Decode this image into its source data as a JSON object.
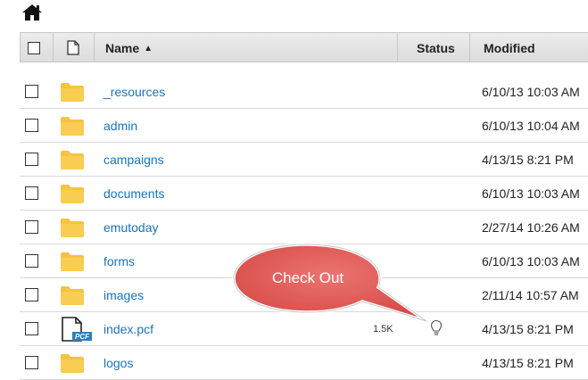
{
  "toolbar": {
    "home_icon": "home-icon"
  },
  "table": {
    "columns": {
      "name": "Name",
      "status": "Status",
      "modified": "Modified"
    },
    "sort": {
      "column": "Name",
      "direction": "ascending",
      "icon": "sort-ascending-icon"
    },
    "rows": [
      {
        "name": "_resources",
        "type": "folder",
        "size": "",
        "status_icon": "",
        "modified": "6/10/13 10:03 AM"
      },
      {
        "name": "admin",
        "type": "folder",
        "size": "",
        "status_icon": "",
        "modified": "6/10/13 10:04 AM"
      },
      {
        "name": "campaigns",
        "type": "folder",
        "size": "",
        "status_icon": "",
        "modified": "4/13/15 8:21 PM"
      },
      {
        "name": "documents",
        "type": "folder",
        "size": "",
        "status_icon": "",
        "modified": "6/10/13 10:03 AM"
      },
      {
        "name": "emutoday",
        "type": "folder",
        "size": "",
        "status_icon": "",
        "modified": "2/27/14 10:26 AM"
      },
      {
        "name": "forms",
        "type": "folder",
        "size": "",
        "status_icon": "",
        "modified": "6/10/13 10:03 AM"
      },
      {
        "name": "images",
        "type": "folder",
        "size": "",
        "status_icon": "",
        "modified": "2/11/14 10:57 AM"
      },
      {
        "name": "index.pcf",
        "type": "pcf-file",
        "file_badge": "PCF",
        "size": "1.5K",
        "status_icon": "lightbulb-icon",
        "modified": "4/13/15 8:21 PM"
      },
      {
        "name": "logos",
        "type": "folder",
        "size": "",
        "status_icon": "",
        "modified": "4/13/15 8:21 PM"
      }
    ]
  },
  "callout": {
    "text": "Check Out",
    "color": "#e05a56"
  },
  "colors": {
    "link": "#1a73b8",
    "folder": "#f5c242",
    "pcf_badge": "#2a7fc4",
    "header_bg": "#e3e3e3"
  }
}
